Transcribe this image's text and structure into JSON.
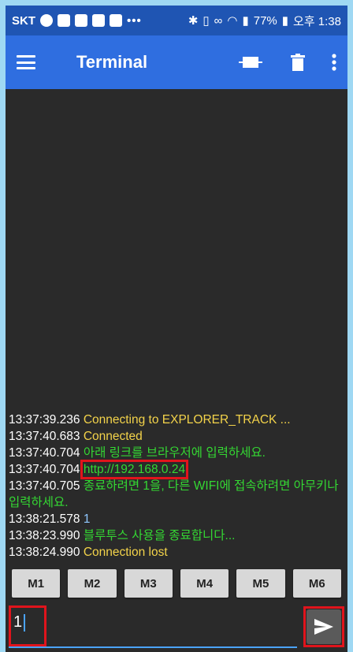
{
  "status_bar": {
    "carrier": "SKT",
    "dots": "•••",
    "battery": "77%",
    "time": "오후 1:38"
  },
  "app_bar": {
    "title": "Terminal"
  },
  "terminal": {
    "lines": [
      {
        "time": "13:37:39.236",
        "text": "Connecting to EXPLORER_TRACK ...",
        "color": "yellow"
      },
      {
        "time": "13:37:40.683",
        "text": "Connected",
        "color": "yellow"
      },
      {
        "time": "13:37:40.704",
        "text": "아래 링크를 브라우저에 입력하세요.",
        "color": "green"
      },
      {
        "time": "13:37:40.704",
        "text": "http://192.168.0.24",
        "color": "green"
      },
      {
        "time": "13:37:40.705",
        "text": "종료하려면 1을, 다른 WIFI에 접속하려면 아무키나 입력하세요.",
        "color": "green"
      },
      {
        "time": "13:38:21.578",
        "text": "1",
        "color": "blue"
      },
      {
        "time": "13:38:23.990",
        "text": "블루투스 사용을 종료합니다...",
        "color": "green"
      },
      {
        "time": "13:38:24.990",
        "text": "Connection lost",
        "color": "yellow"
      }
    ]
  },
  "macros": [
    "M1",
    "M2",
    "M3",
    "M4",
    "M5",
    "M6"
  ],
  "input": {
    "value": "1"
  },
  "colors": {
    "status_bar": "#1f55b3",
    "app_bar": "#2f6ee0",
    "terminal_bg": "#2a2a2a",
    "highlight": "#e0141c"
  }
}
